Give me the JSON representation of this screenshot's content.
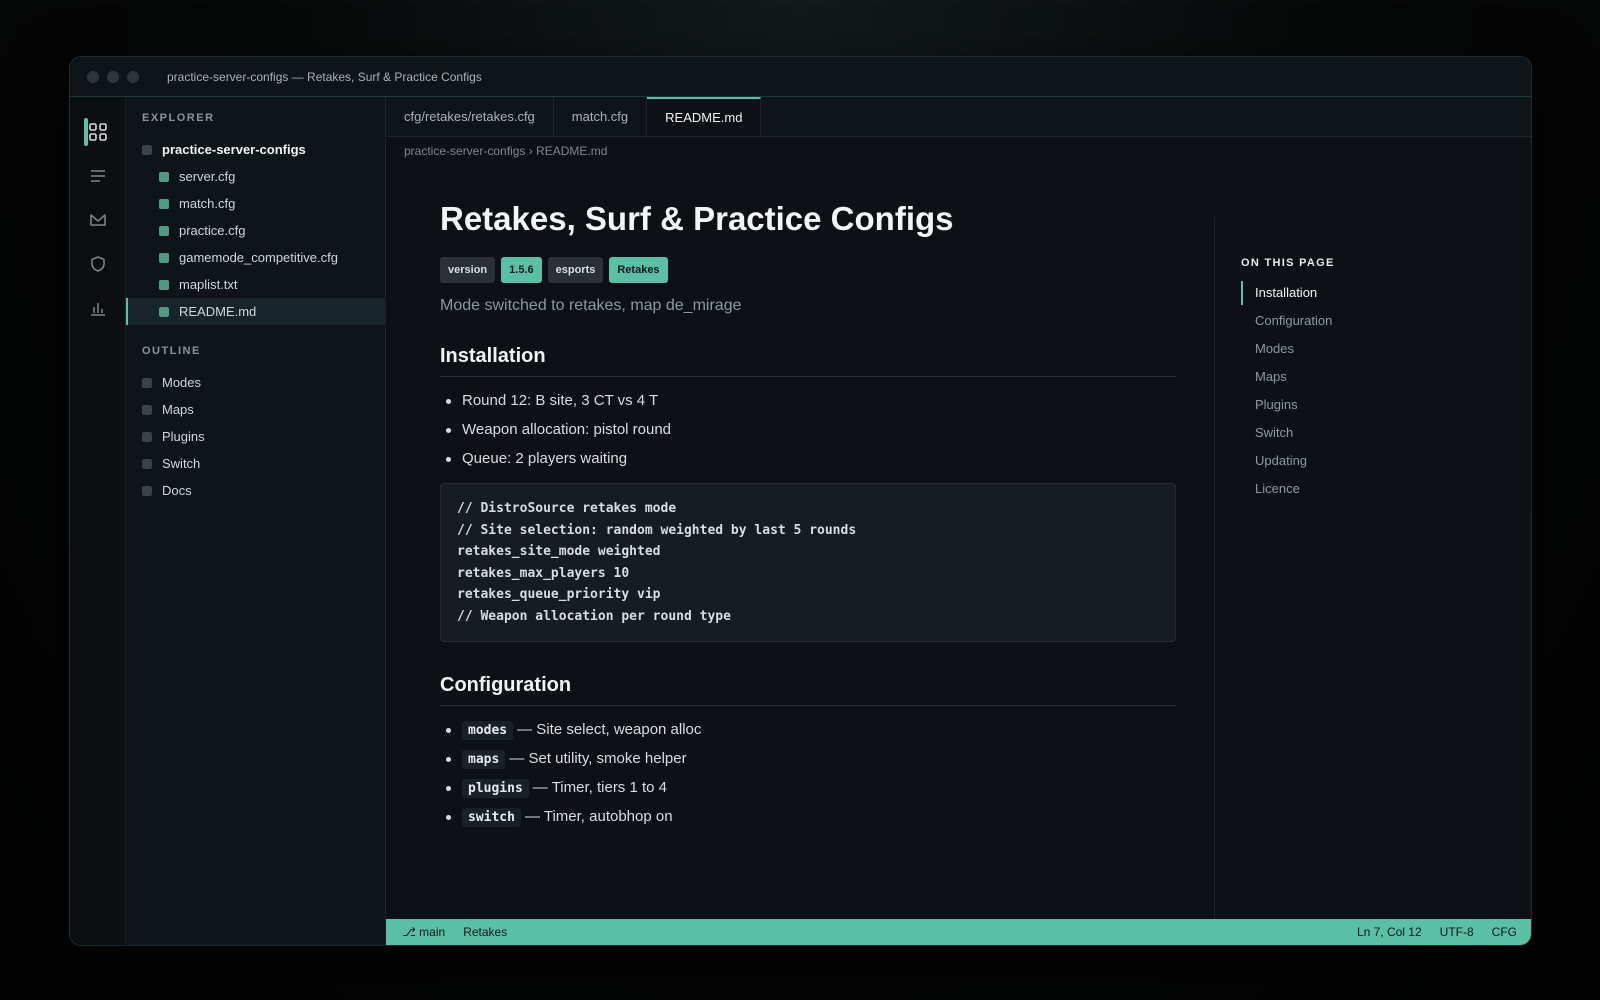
{
  "window": {
    "title": "practice-server-configs — Retakes, Surf & Practice Configs"
  },
  "activity_bar": {
    "items": [
      {
        "icon": "explorer-grid-icon"
      },
      {
        "icon": "outline-list-icon"
      },
      {
        "icon": "mail-icon"
      },
      {
        "icon": "shield-icon"
      },
      {
        "icon": "bar-chart-icon"
      }
    ]
  },
  "explorer": {
    "title": "EXPLORER",
    "root": "practice-server-configs",
    "files": [
      "server.cfg",
      "match.cfg",
      "practice.cfg",
      "gamemode_competitive.cfg",
      "maplist.txt",
      "README.md"
    ],
    "selected": "README.md"
  },
  "outline": {
    "title": "OUTLINE",
    "items": [
      "Modes",
      "Maps",
      "Plugins",
      "Switch",
      "Docs"
    ]
  },
  "tabs": [
    {
      "label": "cfg/retakes/retakes.cfg",
      "active": false
    },
    {
      "label": "match.cfg",
      "active": false
    },
    {
      "label": "README.md",
      "active": true
    }
  ],
  "breadcrumb": "practice-server-configs › README.md",
  "doc": {
    "title": "Retakes, Surf & Practice Configs",
    "badges": [
      {
        "text": "version",
        "style": "dark"
      },
      {
        "text": "1.5.6",
        "style": "accent"
      },
      {
        "text": "esports",
        "style": "dark"
      },
      {
        "text": "Retakes",
        "style": "accent"
      }
    ],
    "subtitle": "Mode switched to retakes, map de_mirage",
    "installation": {
      "heading": "Installation",
      "bullets": [
        "Round 12: B site, 3 CT vs 4 T",
        "Weapon allocation: pistol round",
        "Queue: 2 players waiting"
      ],
      "code": [
        "// DistroSource retakes mode",
        "// Site selection: random weighted by last 5 rounds",
        "retakes_site_mode weighted",
        "retakes_max_players 10",
        "retakes_queue_priority vip",
        "// Weapon allocation per round type"
      ]
    },
    "configuration": {
      "heading": "Configuration",
      "items": [
        {
          "code": "modes",
          "text": "— Site select, weapon alloc"
        },
        {
          "code": "maps",
          "text": "— Set utility, smoke helper"
        },
        {
          "code": "plugins",
          "text": "— Timer, tiers 1 to 4"
        },
        {
          "code": "switch",
          "text": "— Timer, autobhop on"
        }
      ]
    }
  },
  "toc": {
    "title": "ON THIS PAGE",
    "items": [
      "Installation",
      "Configuration",
      "Modes",
      "Maps",
      "Plugins",
      "Switch",
      "Updating",
      "Licence"
    ],
    "active": "Installation"
  },
  "statusbar": {
    "branch": "main",
    "mode": "Retakes",
    "position": "Ln 7, Col 12",
    "encoding": "UTF-8",
    "language": "CFG"
  },
  "colors": {
    "accent": "#5bbfa6",
    "background": "#0d1115",
    "sidebar": "#0f1418"
  }
}
